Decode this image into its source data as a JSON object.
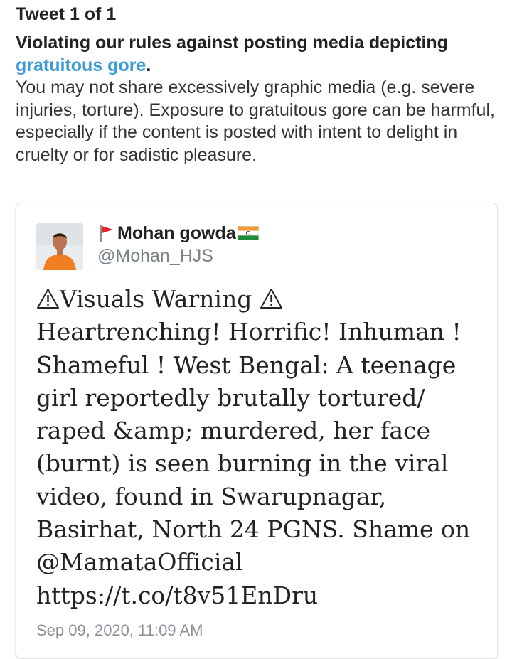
{
  "notice": {
    "tweet_count": "Tweet 1 of 1",
    "heading_prefix": "Violating our rules against posting media depicting",
    "heading_link": "gratuitous gore",
    "heading_suffix": ".",
    "description": "You may not share excessively graphic media (e.g. severe injuries, torture). Exposure to gratuitous gore can be harmful, especially if the content is posted with intent to delight in cruelty or for sadistic pleasure."
  },
  "tweet": {
    "author_name": "Mohan gowda",
    "author_handle": "@Mohan_HJS",
    "warning_label": "Visuals Warning",
    "body_rest": "Heartrenching! Horrific! Inhuman ! Shameful ! West Bengal: A teenage girl reportedly brutally tortured/ raped &amp; murdered, her face (burnt) is seen burning in the viral video, found in Swarupnagar, Basirhat, North 24 PGNS. Shame on @MamataOfficial https://t.co/t8v51EnDru",
    "timestamp": "Sep 09, 2020, 11:09 AM"
  },
  "icons": {
    "name_prefix": "red-flag-icon",
    "name_suffix": "india-flag-icon",
    "warning": "warning-triangle-icon"
  },
  "colors": {
    "link": "#3d9ad9",
    "handle": "#7a8289"
  }
}
